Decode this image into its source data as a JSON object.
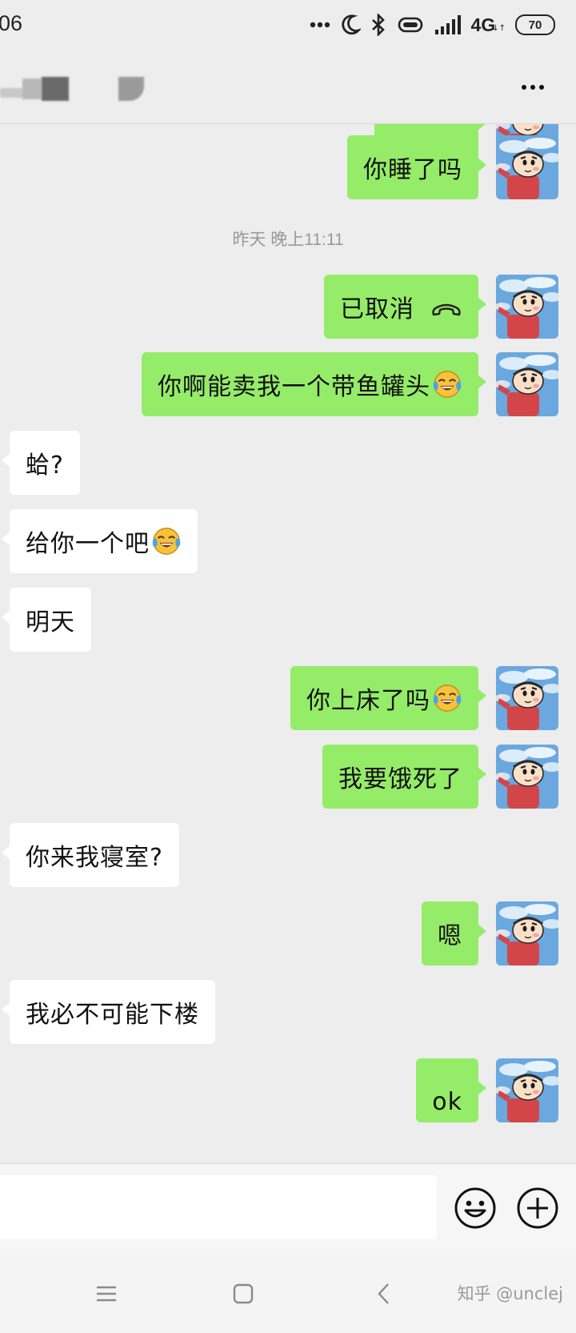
{
  "status_bar": {
    "time": "06",
    "network": "4G",
    "battery": "70"
  },
  "chat": {
    "more_label": "more options"
  },
  "messages": [
    {
      "side": "out",
      "text": "你睡了吗"
    },
    {
      "type": "timestamp",
      "text": "昨天 晚上11:11"
    },
    {
      "side": "out",
      "text": "已取消",
      "icon": "hangup-icon"
    },
    {
      "side": "out",
      "text": "你啊能卖我一个带鱼罐头",
      "emoji": "tears-of-joy"
    },
    {
      "side": "in",
      "text": "蛤?"
    },
    {
      "side": "in",
      "text": "给你一个吧",
      "emoji": "tears-of-joy"
    },
    {
      "side": "in",
      "text": "明天"
    },
    {
      "side": "out",
      "text": "你上床了吗",
      "emoji": "tears-of-joy"
    },
    {
      "side": "out",
      "text": "我要饿死了"
    },
    {
      "side": "in",
      "text": "你来我寝室?"
    },
    {
      "side": "out",
      "text": "嗯"
    },
    {
      "side": "in",
      "text": "我必不可能下楼"
    },
    {
      "side": "out",
      "text": "ok"
    }
  ],
  "input": {
    "value": ""
  },
  "watermark": "知乎 @unclej",
  "colors": {
    "outgoing_bubble": "#95ec69",
    "incoming_bubble": "#ffffff",
    "background": "#ededed"
  }
}
